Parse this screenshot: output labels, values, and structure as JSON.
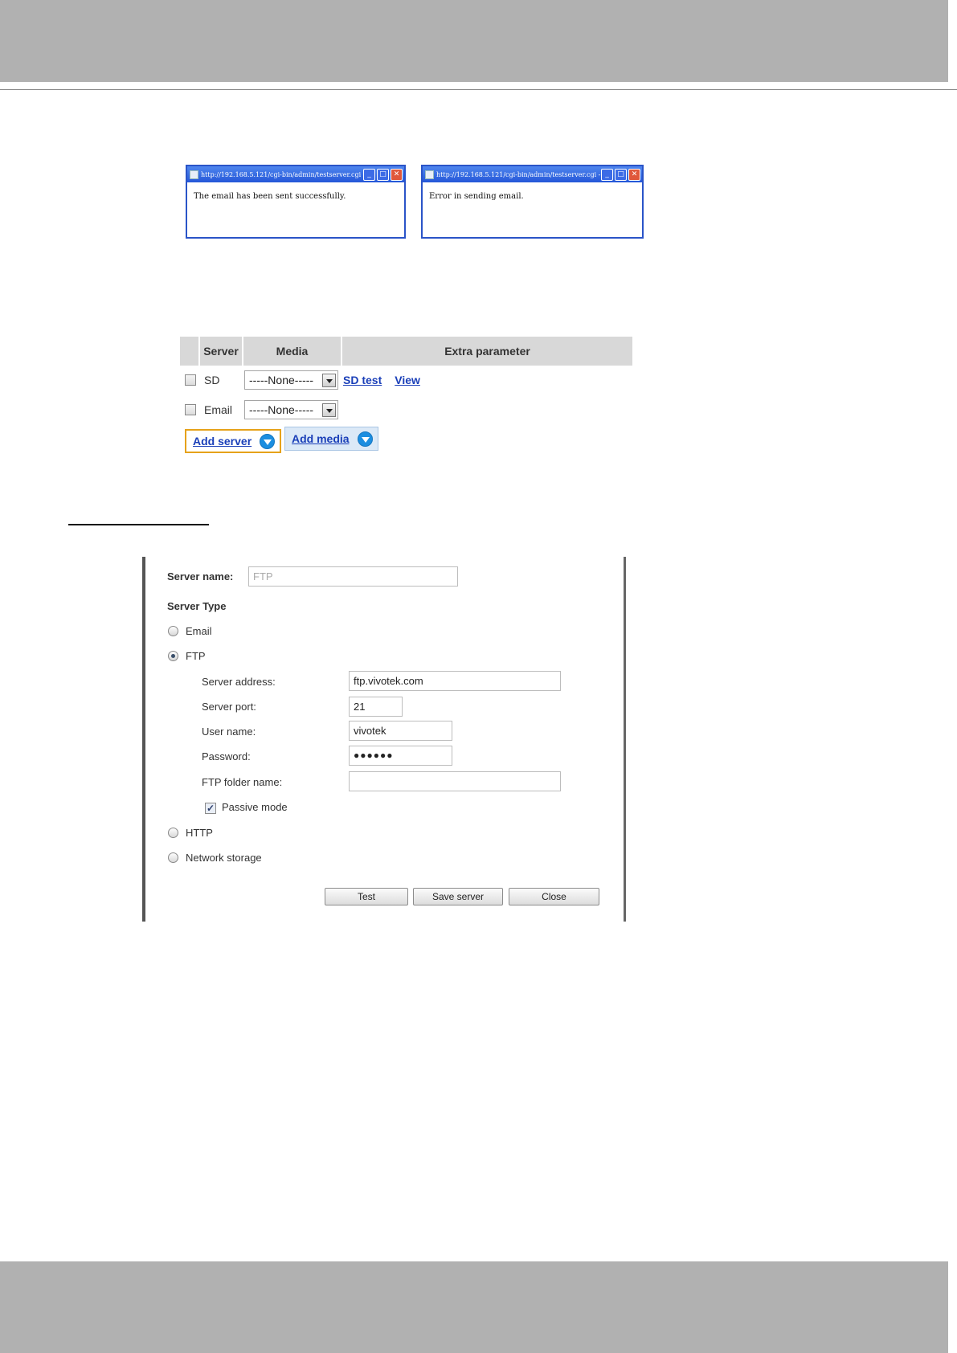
{
  "popups": [
    {
      "title": "http://192.168.5.121/cgi-bin/admin/testserver.cgi - ...",
      "message": "The email has been sent successfully."
    },
    {
      "title": "http://192.168.5.121/cgi-bin/admin/testserver.cgi - ...",
      "message": "Error in sending email."
    }
  ],
  "server_table": {
    "headers": [
      "Server",
      "Media",
      "Extra parameter"
    ],
    "rows": [
      {
        "server": "SD",
        "media": "-----None-----",
        "links": [
          "SD test",
          "View"
        ]
      },
      {
        "server": "Email",
        "media": "-----None-----",
        "links": []
      }
    ],
    "add_server_label": "Add server",
    "add_media_label": "Add media"
  },
  "server_form": {
    "server_name_label": "Server name:",
    "server_name_value": "FTP",
    "server_type_label": "Server Type",
    "types": [
      "Email",
      "FTP",
      "HTTP",
      "Network storage"
    ],
    "selected_type": "FTP",
    "fields": {
      "address_label": "Server address:",
      "address_value": "ftp.vivotek.com",
      "port_label": "Server port:",
      "port_value": "21",
      "user_label": "User name:",
      "user_value": "vivotek",
      "password_label": "Password:",
      "password_value": "●●●●●●",
      "folder_label": "FTP folder name:",
      "folder_value": ""
    },
    "passive_mode_label": "Passive mode",
    "passive_mode_checked": true,
    "buttons": {
      "test": "Test",
      "save": "Save server",
      "close": "Close"
    }
  },
  "colors": {
    "band": "#b1b1b1",
    "link": "#1a3fb8",
    "highlight_border": "#e6a21a",
    "titlebar": "#2456d8"
  }
}
